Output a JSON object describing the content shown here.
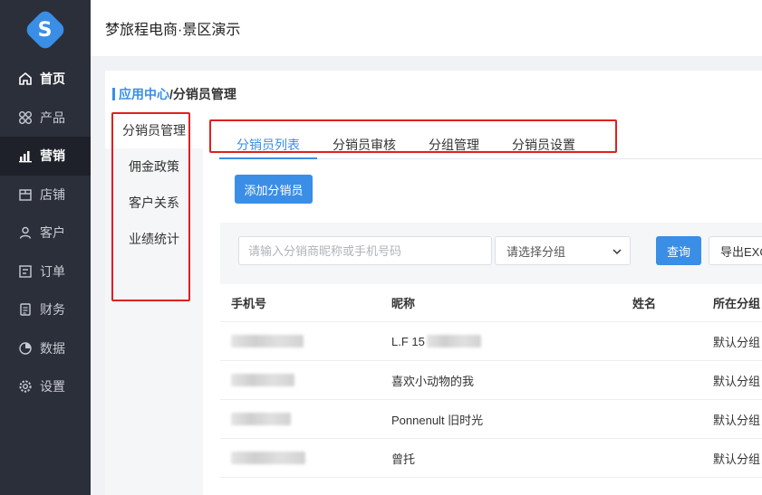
{
  "sidebar": {
    "logo_letter": "S",
    "items": [
      {
        "label": "首页",
        "icon": "home-icon"
      },
      {
        "label": "产品",
        "icon": "grid-icon"
      },
      {
        "label": "营销",
        "icon": "bar-chart-icon"
      },
      {
        "label": "店铺",
        "icon": "store-icon"
      },
      {
        "label": "客户",
        "icon": "user-icon"
      },
      {
        "label": "订单",
        "icon": "order-icon"
      },
      {
        "label": "财务",
        "icon": "finance-icon"
      },
      {
        "label": "数据",
        "icon": "pie-chart-icon"
      },
      {
        "label": "设置",
        "icon": "gear-icon"
      }
    ]
  },
  "header": {
    "title": "梦旅程电商·景区演示"
  },
  "breadcrumb": {
    "link": "应用中心",
    "current": "/分销员管理"
  },
  "subnav": {
    "items": [
      "分销员管理",
      "佣金政策",
      "客户关系",
      "业绩统计"
    ]
  },
  "tabs": [
    "分销员列表",
    "分销员审核",
    "分组管理",
    "分销员设置"
  ],
  "actions": {
    "add_label": "添加分销员"
  },
  "filter": {
    "search_placeholder": "请输入分销商昵称或手机号码",
    "group_select": "请选择分组",
    "query_label": "查询",
    "export_label": "导出EXCEL"
  },
  "table": {
    "columns": [
      "手机号",
      "昵称",
      "姓名",
      "所在分组"
    ],
    "rows": [
      {
        "nickname": "L.F 15",
        "group": "默认分组"
      },
      {
        "nickname": "喜欢小动物的我",
        "group": "默认分组"
      },
      {
        "nickname": "Ponnenult 旧时光",
        "group": "默认分组"
      },
      {
        "nickname": "曾托",
        "group": "默认分组"
      }
    ]
  },
  "colors": {
    "accent": "#3a8ee6",
    "sidebar": "#2b2f3a",
    "annotation": "#e02020"
  }
}
